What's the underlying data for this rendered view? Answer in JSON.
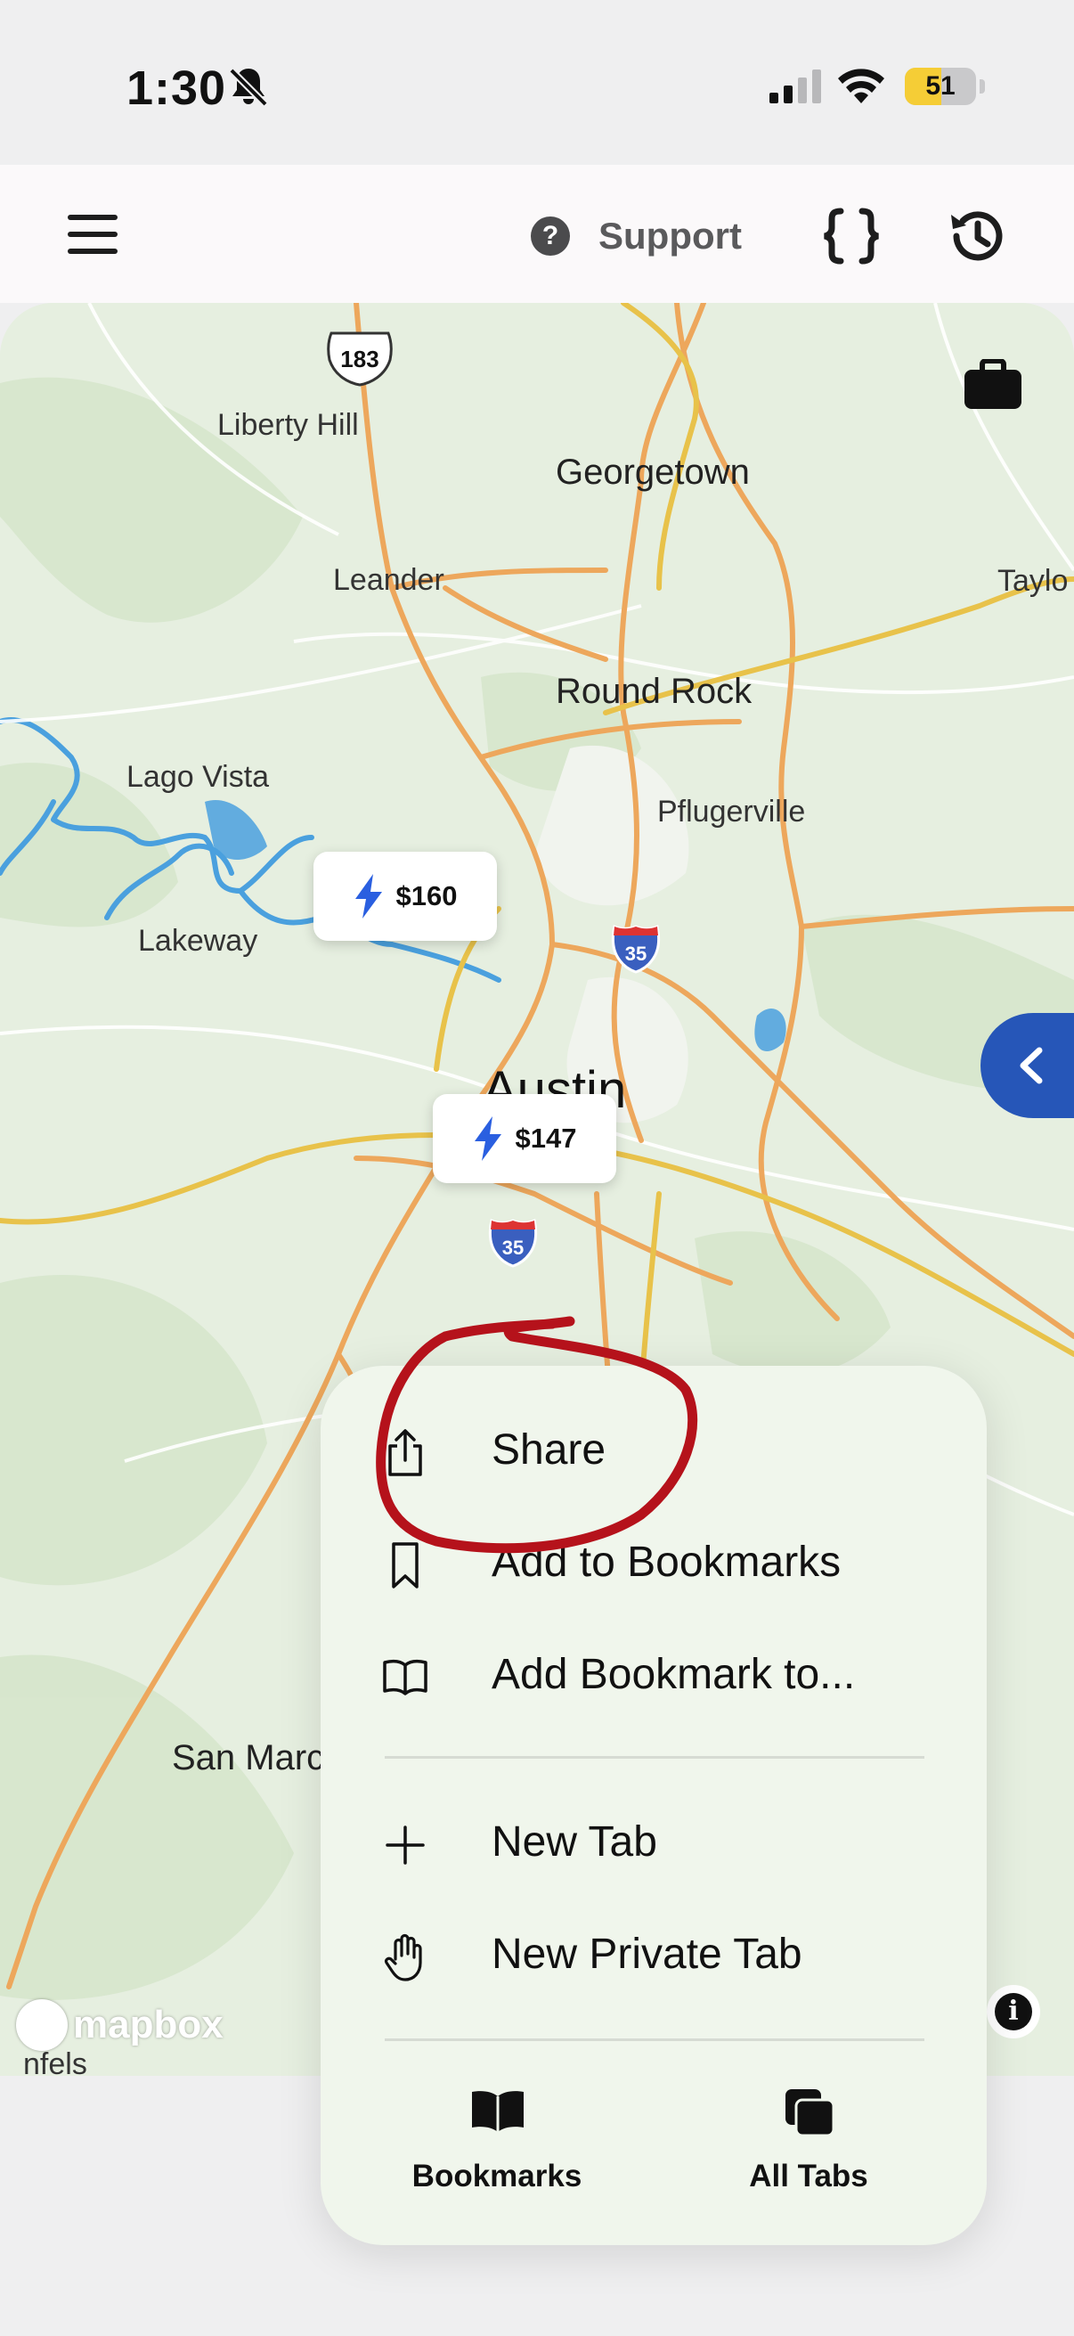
{
  "status_bar": {
    "time": "1:30",
    "battery_percent": "51",
    "battery_level": 0.51,
    "silent_mode_icon": "bell-slash-icon",
    "signal_icon": "cellular-signal-icon",
    "wifi_icon": "wifi-icon"
  },
  "header": {
    "menu_icon": "hamburger-menu-icon",
    "support_label": "Support",
    "support_icon": "question-circle-icon",
    "brace_icon": "curly-braces-icon",
    "history_icon": "history-clock-icon"
  },
  "map": {
    "places": {
      "liberty_hill": "Liberty Hill",
      "georgetown": "Georgetown",
      "leander": "Leander",
      "taylor": "Taylo",
      "round_rock": "Round Rock",
      "lago_vista": "Lago Vista",
      "pflugerville": "Pflugerville",
      "lakeway": "Lakeway",
      "austin": "Austin",
      "san_marcos": "San Marc",
      "new_braunfels": "nfels"
    },
    "shields": {
      "us183": "183",
      "i35_north": "35",
      "i35_south": "35"
    },
    "pins": [
      {
        "price": "$160",
        "icon": "lightning-bolt-icon"
      },
      {
        "price": "$147",
        "icon": "lightning-bolt-icon"
      }
    ],
    "attribution": "mapbox",
    "info_label": "i",
    "colors": {
      "land": "#e6efe0",
      "road": "#eda75c",
      "highway": "#e8c24a",
      "water": "#4aa0de",
      "pin_icon": "#2a5fe0",
      "side_tab": "#2656b8"
    }
  },
  "context_menu": {
    "items": [
      {
        "label": "Share",
        "icon": "share-icon"
      },
      {
        "label": "Add to Bookmarks",
        "icon": "bookmark-icon"
      },
      {
        "label": "Add Bookmark to...",
        "icon": "book-open-icon"
      },
      {
        "label": "New Tab",
        "icon": "plus-icon"
      },
      {
        "label": "New Private Tab",
        "icon": "hand-icon"
      }
    ],
    "tab_buttons": {
      "bookmarks": "Bookmarks",
      "all_tabs": "All Tabs"
    }
  },
  "annotation": {
    "color": "#b5121b",
    "shape": "hand-drawn circle around Share"
  }
}
